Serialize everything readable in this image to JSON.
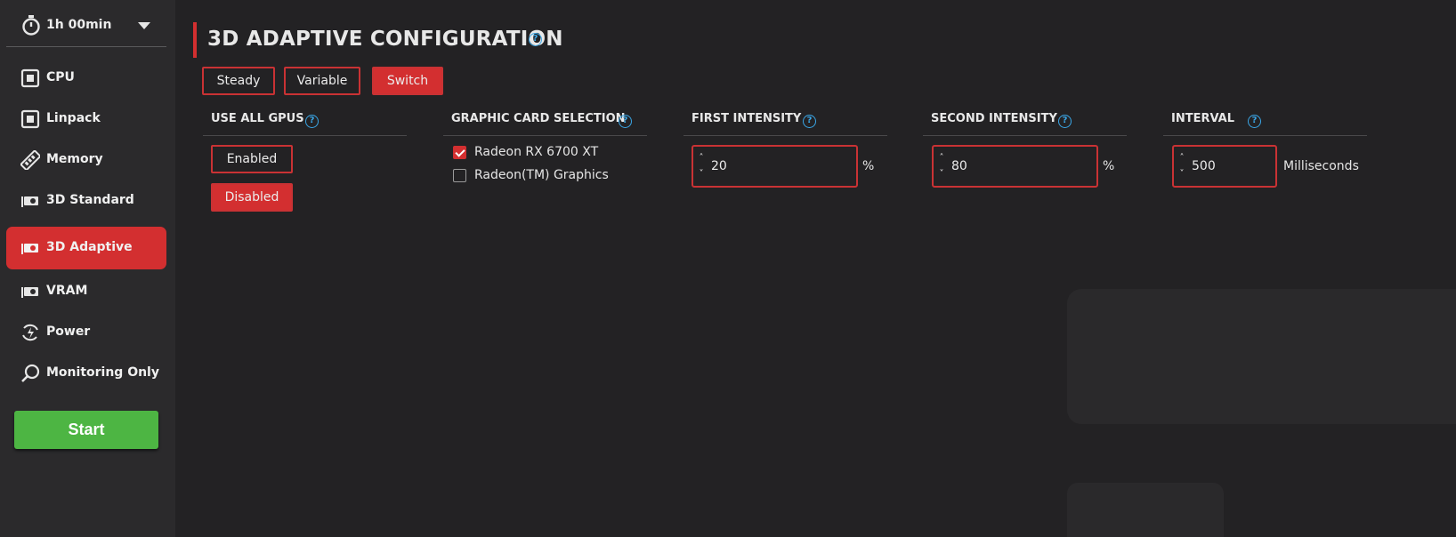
{
  "timer": {
    "label": "1h 00min",
    "icon": "stopwatch-icon"
  },
  "sidebar": {
    "items": [
      {
        "label": "CPU",
        "icon": "chip-icon"
      },
      {
        "label": "Linpack",
        "icon": "chip-icon"
      },
      {
        "label": "Memory",
        "icon": "memory-stick-icon"
      },
      {
        "label": "3D Standard",
        "icon": "gpu-card-icon"
      },
      {
        "label": "3D Adaptive",
        "icon": "gpu-card-icon"
      },
      {
        "label": "VRAM",
        "icon": "gpu-card-icon"
      },
      {
        "label": "Power",
        "icon": "power-cycle-icon"
      },
      {
        "label": "Monitoring Only",
        "icon": "magnifier-icon"
      }
    ],
    "active": "3D Adaptive",
    "start_label": "Start"
  },
  "page": {
    "title": "3D ADAPTIVE CONFIGURATION",
    "modes": [
      "Steady",
      "Variable",
      "Switch"
    ],
    "selected_mode": "Switch"
  },
  "use_all_gpus": {
    "heading": "USE ALL GPUS",
    "enabled_label": "Enabled",
    "disabled_label": "Disabled",
    "selected": "Disabled"
  },
  "graphic_card_selection": {
    "heading": "GRAPHIC CARD SELECTION",
    "cards": [
      {
        "label": "Radeon RX 6700 XT",
        "checked": true
      },
      {
        "label": "Radeon(TM) Graphics",
        "checked": false
      }
    ]
  },
  "first_intensity": {
    "heading": "FIRST INTENSITY",
    "value": "20",
    "unit": "%"
  },
  "second_intensity": {
    "heading": "SECOND INTENSITY",
    "value": "80",
    "unit": "%"
  },
  "interval": {
    "heading": "INTERVAL",
    "value": "500",
    "unit": "Milliseconds"
  },
  "colors": {
    "accent": "#d32f30",
    "start": "#4db543",
    "help": "#3aa6e6",
    "background": "#232224",
    "sidebar": "#2b2a2c"
  }
}
